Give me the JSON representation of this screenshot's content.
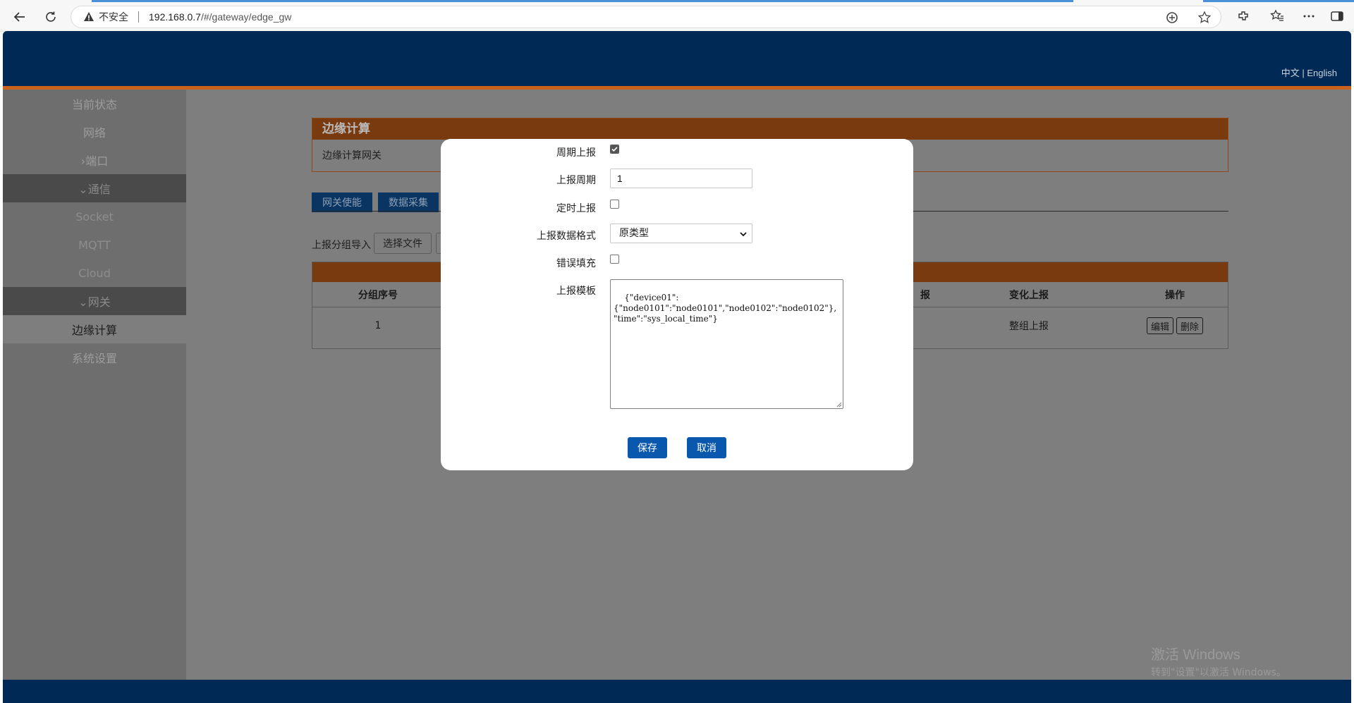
{
  "browser": {
    "insecure_label": "不安全",
    "url_host": "192.168.0.7",
    "url_path": "/#/gateway/edge_gw"
  },
  "header": {
    "lang_zh": "中文",
    "lang_sep": " | ",
    "lang_en": "English"
  },
  "sidebar": {
    "items": [
      {
        "label": "当前状态"
      },
      {
        "label": "网络"
      },
      {
        "label": "›端口"
      },
      {
        "label": "⌄通信"
      },
      {
        "label": "Socket"
      },
      {
        "label": "MQTT"
      },
      {
        "label": "Cloud"
      },
      {
        "label": "⌄网关"
      },
      {
        "label": "边缘计算"
      },
      {
        "label": "系统设置"
      }
    ]
  },
  "page": {
    "panel_title": "边缘计算",
    "panel_subtitle": "边缘计算网关",
    "tabs": [
      "网关使能",
      "数据采集"
    ],
    "import_label": "上报分组导入",
    "choose_file": "选择文件",
    "table": {
      "headers": [
        "分组序号",
        "报",
        "变化上报",
        "操作"
      ],
      "rows": [
        {
          "index": "1",
          "change_report": "整组上报",
          "edit": "编辑",
          "delete": "删除"
        }
      ]
    }
  },
  "modal": {
    "periodic_label": "周期上报",
    "periodic_checked": true,
    "period_label": "上报周期",
    "period_value": "1",
    "timed_label": "定时上报",
    "timed_checked": false,
    "format_label": "上报数据格式",
    "format_value": "原类型",
    "error_fill_label": "错误填充",
    "error_fill_checked": false,
    "template_label": "上报模板",
    "template_value": "{\"device01\":\n{\"node0101\":\"node0101\",\"node0102\":\"node0102\"},\n\"time\":\"sys_local_time\"}",
    "save": "保存",
    "cancel": "取消"
  },
  "watermark": {
    "line1": "激活 Windows",
    "line2": "转到\"设置\"以激活 Windows。"
  }
}
